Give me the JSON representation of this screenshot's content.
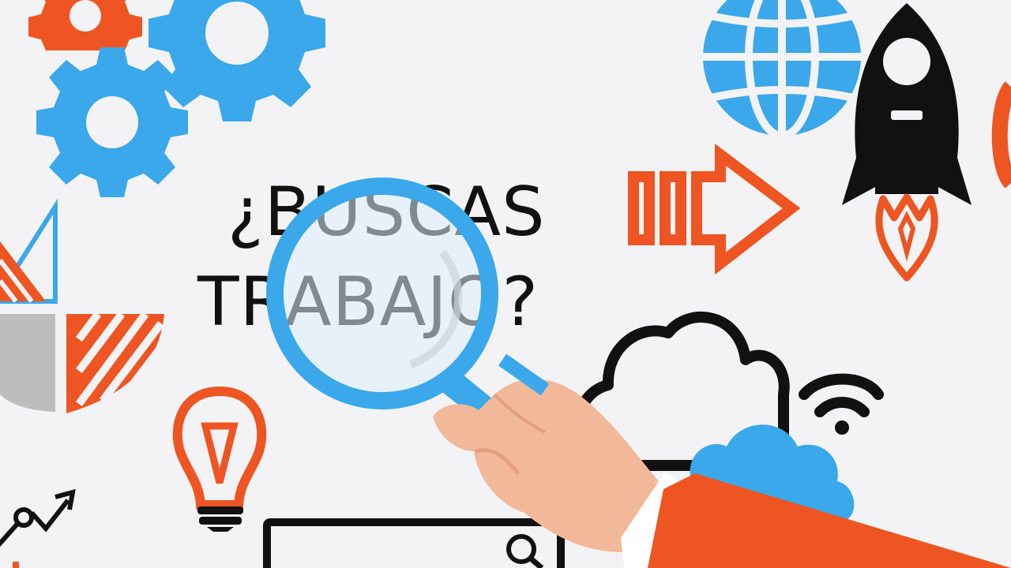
{
  "headline": {
    "line1": "¿BUSCAS",
    "line2": "TRABAJO?"
  },
  "colors": {
    "blue": "#3aa8ea",
    "orange": "#ee5522",
    "black": "#111111",
    "gray": "#bdbdbd",
    "skin": "#f2b89a",
    "background": "#f3f3f5"
  },
  "icons": [
    "orange-gear-icon",
    "blue-gear-large-icon",
    "blue-gear-small-icon",
    "globe-icon",
    "rocket-icon",
    "arrow-right-icon",
    "pie-chart-icon",
    "lightbulb-icon",
    "trend-arrow-icon",
    "cloud-outline-icon",
    "cloud-blue-icon",
    "wifi-icon",
    "search-bar-icon",
    "magnifying-glass-icon",
    "hand-icon"
  ]
}
